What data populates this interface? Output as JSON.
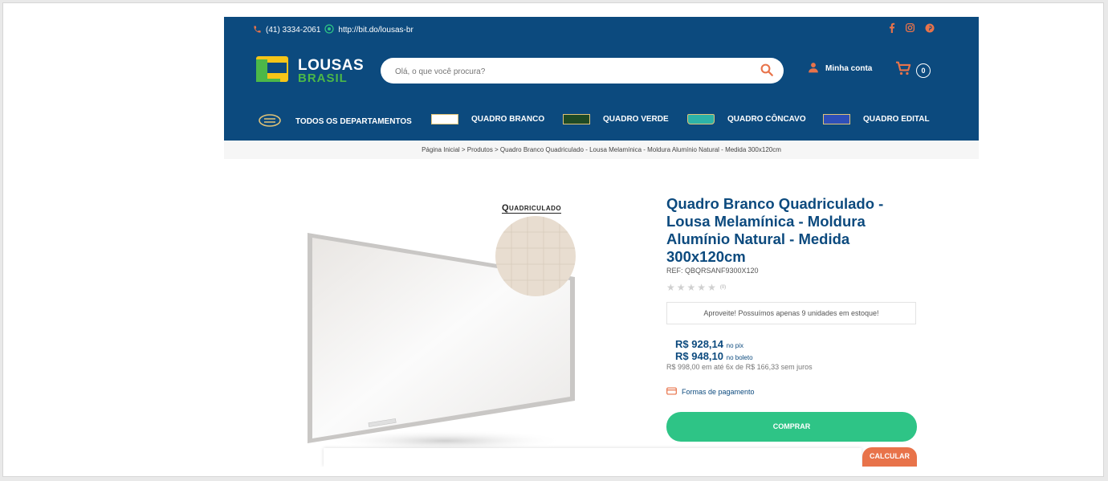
{
  "topbar": {
    "phone": "(41) 3334-2061",
    "whatsapp_link": "http://bit.do/lousas-br",
    "social_icons": [
      "facebook-icon",
      "instagram-icon",
      "pinterest-icon"
    ]
  },
  "header": {
    "logo_top": "LOUSAS",
    "logo_bottom": "BRASIL",
    "search_placeholder": "Olá, o que você procura?",
    "account_label": "Minha conta",
    "cart_count": "0"
  },
  "nav": {
    "items": [
      {
        "label": "TODOS OS DEPARTAMENTOS"
      },
      {
        "label": "QUADRO BRANCO"
      },
      {
        "label": "QUADRO VERDE"
      },
      {
        "label": "QUADRO CÔNCAVO"
      },
      {
        "label": "QUADRO EDITAL"
      }
    ]
  },
  "breadcrumb": "Página Inicial > Produtos > Quadro Branco Quadriculado - Lousa Melamínica - Moldura Alumínio Natural - Medida 300x120cm",
  "product": {
    "image_caption": "Quadriculado",
    "title": "Quadro Branco Quadriculado - Lousa Melamínica - Moldura Alumínio Natural - Medida 300x120cm",
    "ref": "REF: QBQRSANF9300X120",
    "rating": 0,
    "reviews_count": "(0)",
    "stock_message": "Aproveite! Possuímos apenas 9 unidades em estoque!",
    "price_pix": "R$ 928,14",
    "price_pix_label": "no pix",
    "price_boleto": "R$ 948,10",
    "price_boleto_label": "no boleto",
    "installments": "R$ 998,00 em até 6x de R$ 166,33 sem juros",
    "payment_methods_label": "Formas de pagamento",
    "buy_label": "COMPRAR",
    "calc_label": "CALCULAR"
  },
  "colors": {
    "brand_blue": "#0c4a7e",
    "buy_green": "#2ec486",
    "calc_orange": "#e8734a",
    "logo_yellow": "#f5c518",
    "logo_green": "#4cb848"
  }
}
